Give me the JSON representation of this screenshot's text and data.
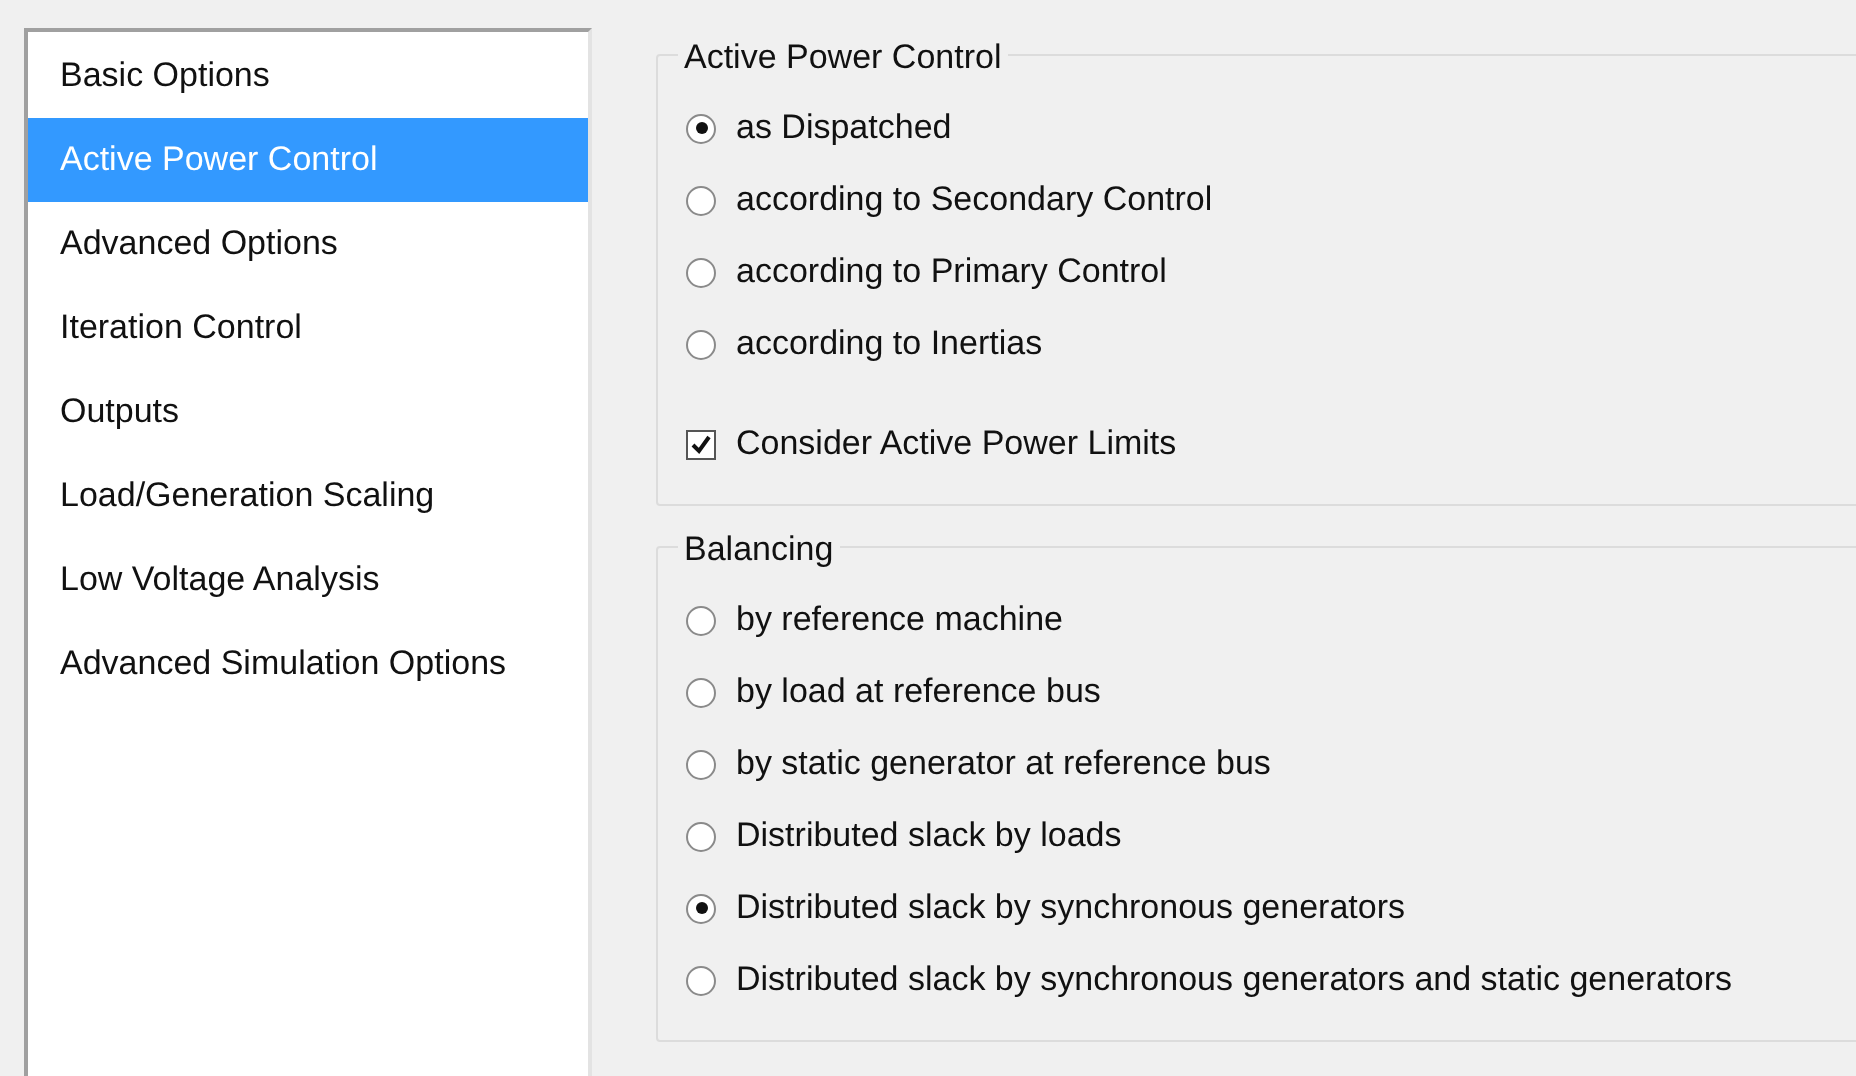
{
  "sidebar": {
    "items": [
      {
        "label": "Basic Options",
        "selected": false
      },
      {
        "label": "Active Power Control",
        "selected": true
      },
      {
        "label": "Advanced Options",
        "selected": false
      },
      {
        "label": "Iteration Control",
        "selected": false
      },
      {
        "label": "Outputs",
        "selected": false
      },
      {
        "label": "Load/Generation Scaling",
        "selected": false
      },
      {
        "label": "Low Voltage Analysis",
        "selected": false
      },
      {
        "label": "Advanced Simulation Options",
        "selected": false
      }
    ]
  },
  "groups": [
    {
      "title": "Active Power Control",
      "options": [
        {
          "kind": "radio",
          "label": "as Dispatched",
          "selected": true
        },
        {
          "kind": "radio",
          "label": "according to Secondary Control",
          "selected": false
        },
        {
          "kind": "radio",
          "label": "according to Primary Control",
          "selected": false
        },
        {
          "kind": "radio",
          "label": "according to Inertias",
          "selected": false
        },
        {
          "kind": "checkbox",
          "label": "Consider Active Power Limits",
          "checked": true
        }
      ]
    },
    {
      "title": "Balancing",
      "options": [
        {
          "kind": "radio",
          "label": "by reference machine",
          "selected": false
        },
        {
          "kind": "radio",
          "label": "by load at reference bus",
          "selected": false
        },
        {
          "kind": "radio",
          "label": "by static generator at reference bus",
          "selected": false
        },
        {
          "kind": "radio",
          "label": "Distributed slack by loads",
          "selected": false
        },
        {
          "kind": "radio",
          "label": "Distributed slack by synchronous generators",
          "selected": true
        },
        {
          "kind": "radio",
          "label": "Distributed slack by synchronous generators and static generators",
          "selected": false
        }
      ]
    }
  ]
}
